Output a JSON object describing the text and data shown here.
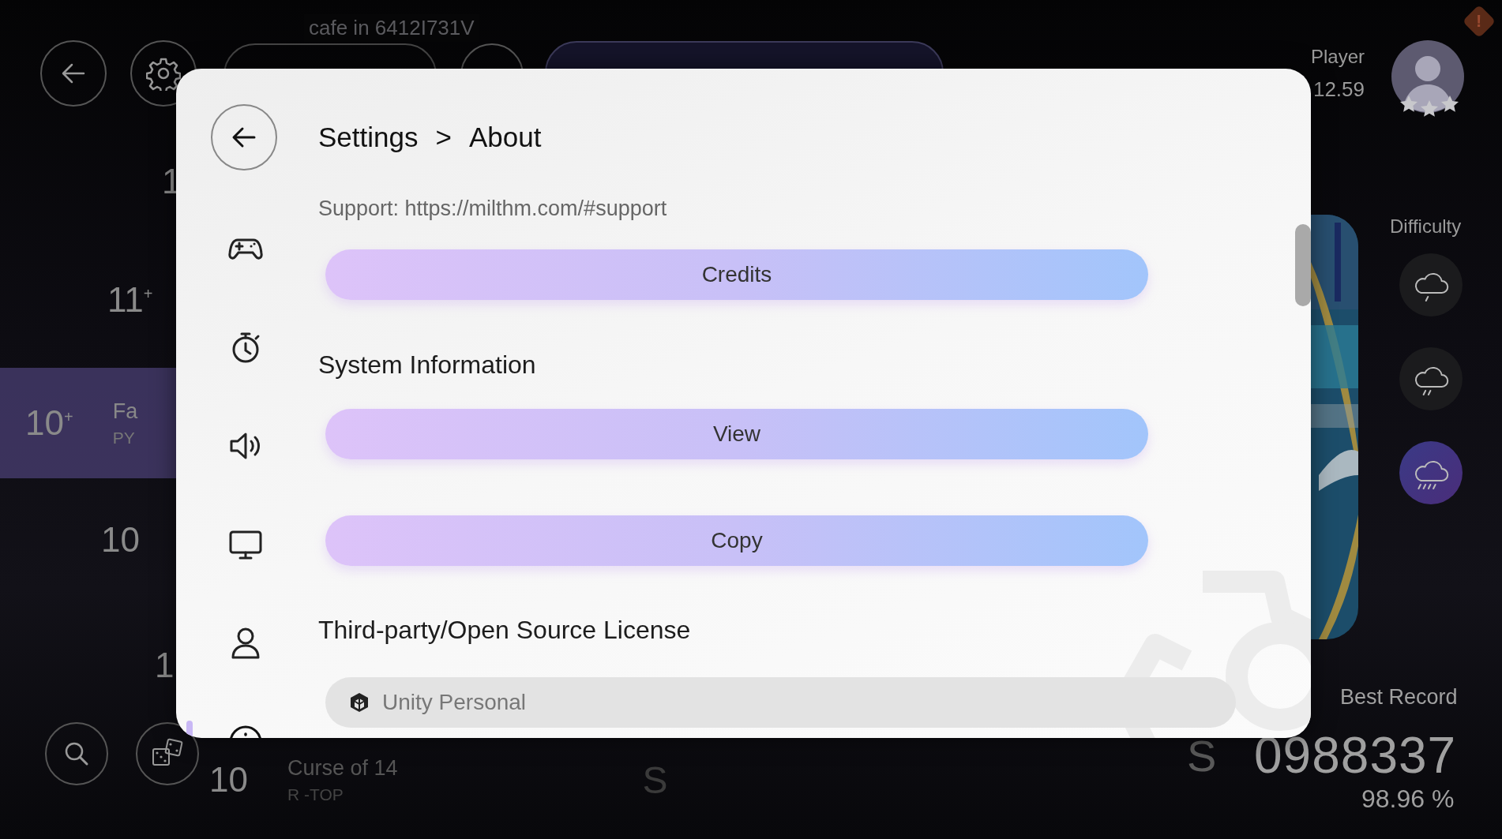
{
  "top_bar": {
    "song_caption": "cafe in 6412I731V"
  },
  "player": {
    "name": "Player",
    "rating": "12.59",
    "badge": "!",
    "stars": 3
  },
  "song_list": [
    {
      "level": "1",
      "selected": false
    },
    {
      "level": "11$^{+}$",
      "selected": false
    },
    {
      "level": "10$^{+}$",
      "title": "Fa",
      "artist": "PY",
      "selected": true
    },
    {
      "level": "10",
      "selected": false
    },
    {
      "level": "1",
      "selected": false
    },
    {
      "level": "10",
      "title": "Curse of 14",
      "artist": "R -TOP",
      "rank": "S",
      "selected": false
    }
  ],
  "difficulty": {
    "label": "Difficulty",
    "levels": [
      {
        "selected": false
      },
      {
        "selected": false
      },
      {
        "selected": true
      }
    ]
  },
  "record": {
    "label": "Best Record",
    "rank": "S",
    "score": "0988337",
    "accuracy": "98.96 %"
  },
  "settings": {
    "breadcrumb": [
      "Settings",
      ">",
      "About"
    ],
    "sidebar": {
      "items": [
        {
          "selected": false
        },
        {
          "selected": false
        },
        {
          "selected": false
        },
        {
          "selected": false
        },
        {
          "selected": false
        },
        {
          "selected": true
        }
      ]
    },
    "content": [
      {
        "kind": "text",
        "text": "Support: https://milthm.com/#support"
      },
      {
        "kind": "button",
        "label": "Credits"
      },
      {
        "kind": "heading",
        "text": "System Information"
      },
      {
        "kind": "button",
        "label": "View"
      },
      {
        "kind": "button",
        "label": "Copy"
      },
      {
        "kind": "heading",
        "text": "Third-party/Open Source License"
      },
      {
        "kind": "license",
        "label": "Unity Personal"
      }
    ]
  }
}
